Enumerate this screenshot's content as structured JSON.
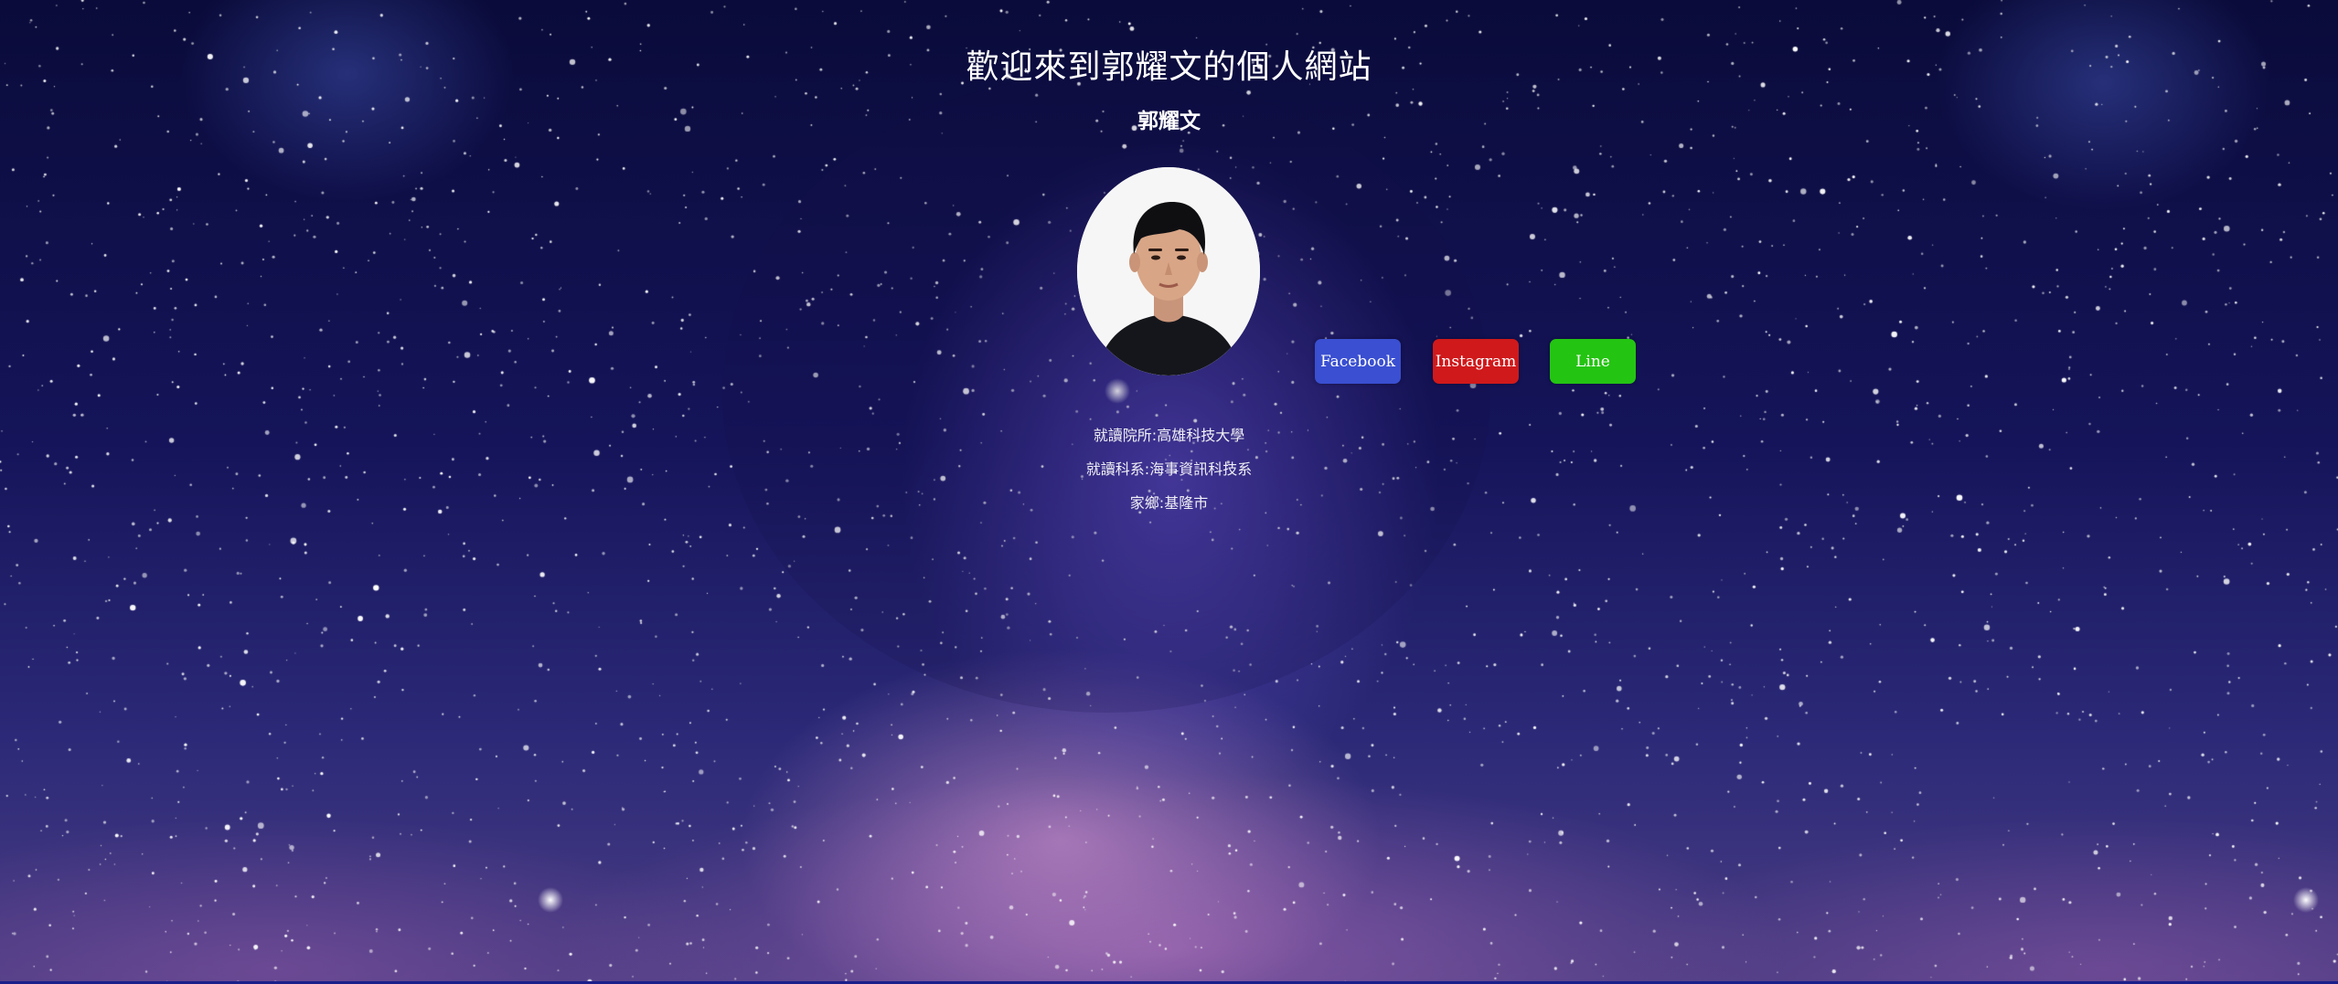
{
  "page": {
    "title": "歡迎來到郭耀文的個人網站",
    "name": "郭耀文"
  },
  "profile": {
    "photo_icon": "profile-photo",
    "school": "就讀院所:高雄科技大學",
    "department": "就讀科系:海事資訊科技系",
    "hometown": "家鄉:基隆市"
  },
  "social": {
    "facebook_label": "Facebook",
    "instagram_label": "Instagram",
    "line_label": "Line",
    "colors": {
      "facebook": "#3a4fd1",
      "instagram": "#d0191b",
      "line": "#24c412"
    }
  },
  "background": {
    "theme": "starry-galaxy",
    "colors": {
      "sky_top": "#0a0b3a",
      "galaxy": "#785fe6",
      "nebula": "#eba5dc"
    }
  }
}
